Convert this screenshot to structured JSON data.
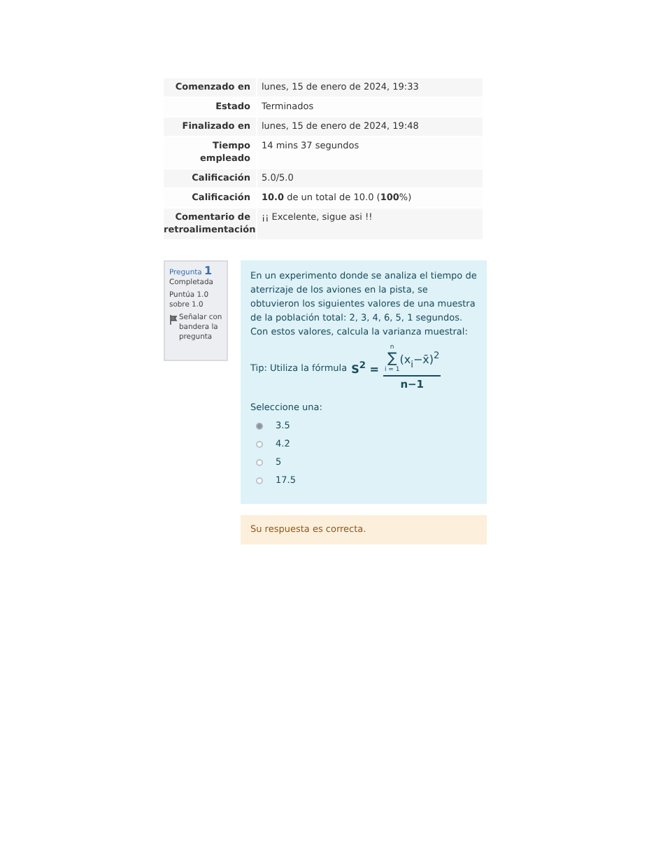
{
  "summary": [
    {
      "label": "Comenzado en",
      "value": "lunes, 15 de enero de 2024, 19:33"
    },
    {
      "label": "Estado",
      "value": "Terminados"
    },
    {
      "label": "Finalizado en",
      "value": "lunes, 15 de enero de 2024, 19:48"
    },
    {
      "label": "Tiempo empleado",
      "value": "14 mins 37 segundos"
    },
    {
      "label": "Calificación",
      "value": "5.0/5.0"
    },
    {
      "label": "Calificación",
      "value": "**10.0** de un total de 10.0 (**100**%)"
    },
    {
      "label": "Comentario de retroalimentación",
      "value": "¡¡ Excelente, sigue asi !!"
    }
  ],
  "question_info": {
    "label": "Pregunta",
    "number": "1",
    "status": "Completada",
    "points": "Puntúa 1.0 sobre 1.0",
    "flag": "Señalar con bandera la pregunta"
  },
  "question": {
    "text": "En un experimento donde se analiza el  tiempo de aterrizaje de los aviones en la pista, se obtuvieron los siguientes valores de una muestra de la población total: 2, 3, 4, 6, 5, 1 segundos. Con estos valores, calcula la varianza muestral:",
    "tip": "Tip: Utiliza la fórmula",
    "formula": {
      "lhs": "S$^{2}$ =",
      "sigma": "∑",
      "sum_top": "n",
      "sum_bottom": "i = 1",
      "numerator": "(x$_{i}$−x̄)$^{2}$",
      "denominator": "n−1"
    },
    "prompt": "Seleccione una:",
    "options": [
      {
        "label": "3.5",
        "selected": true
      },
      {
        "label": "4.2",
        "selected": false
      },
      {
        "label": "5",
        "selected": false
      },
      {
        "label": "17.5",
        "selected": false
      }
    ]
  },
  "feedback": "Su respuesta es correcta."
}
